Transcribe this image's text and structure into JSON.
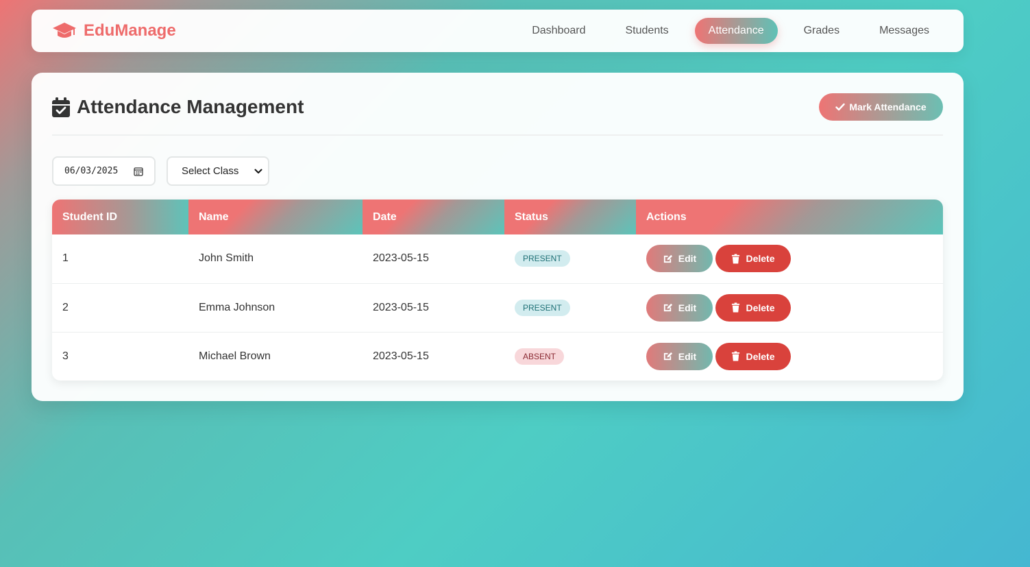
{
  "app": {
    "name": "EduManage",
    "icon": "graduation-cap-icon"
  },
  "nav": {
    "items": [
      {
        "label": "Dashboard",
        "active": false
      },
      {
        "label": "Students",
        "active": false
      },
      {
        "label": "Attendance",
        "active": true
      },
      {
        "label": "Grades",
        "active": false
      },
      {
        "label": "Messages",
        "active": false
      }
    ]
  },
  "page": {
    "title": "Attendance Management",
    "title_icon": "calendar-check-icon",
    "mark_button": {
      "label": "Mark Attendance",
      "icon": "check-icon"
    }
  },
  "filters": {
    "date": {
      "value": "06/03/2025",
      "icon": "calendar-icon"
    },
    "class_select": {
      "selected": "Select Class",
      "icon": "chevron-down-icon"
    }
  },
  "table": {
    "headers": [
      "Student ID",
      "Name",
      "Date",
      "Status",
      "Actions"
    ],
    "rows": [
      {
        "id": "1",
        "name": "John Smith",
        "date": "2023-05-15",
        "status": "PRESENT"
      },
      {
        "id": "2",
        "name": "Emma Johnson",
        "date": "2023-05-15",
        "status": "PRESENT"
      },
      {
        "id": "3",
        "name": "Michael Brown",
        "date": "2023-05-15",
        "status": "ABSENT"
      }
    ],
    "edit_label": "Edit",
    "delete_label": "Delete",
    "edit_icon": "edit-icon",
    "delete_icon": "trash-icon"
  },
  "colors": {
    "brand": "#ee6b6b",
    "accent_teal": "#4ecdc4",
    "delete": "#d9423c",
    "present_bg": "#d2ecef",
    "absent_bg": "#f8d7da"
  }
}
